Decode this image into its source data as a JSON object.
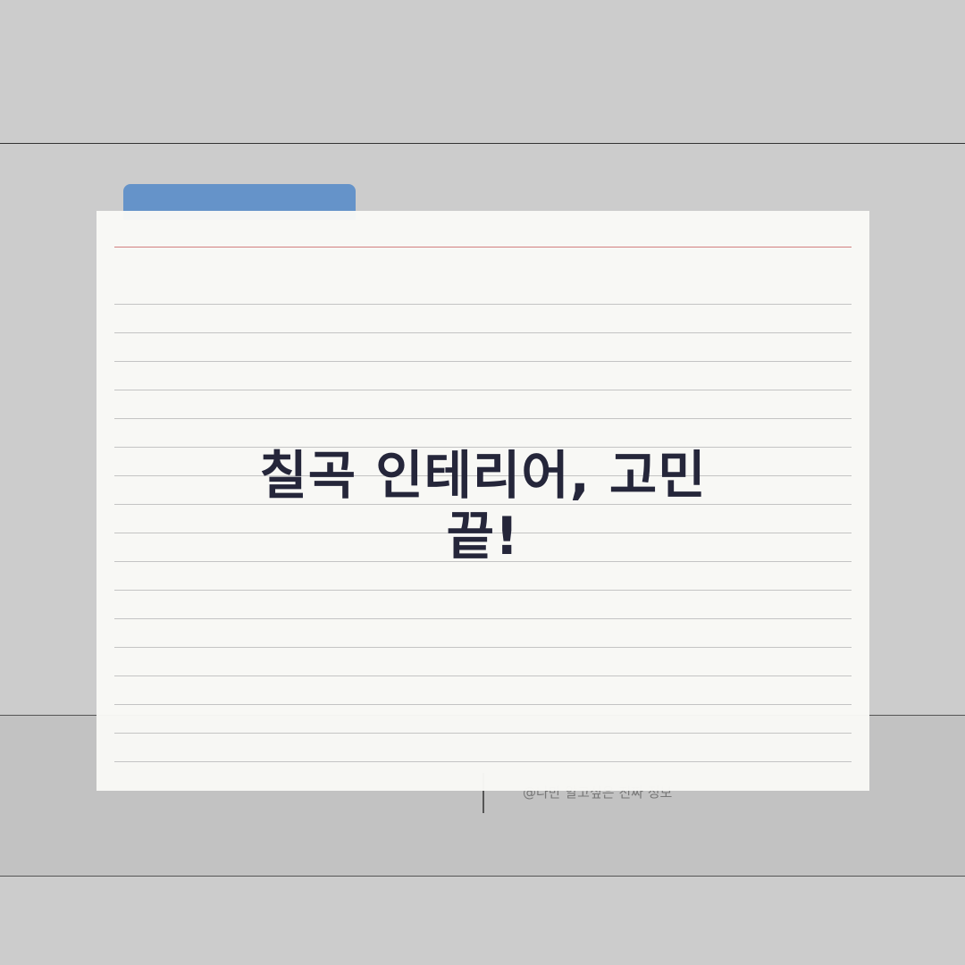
{
  "card": {
    "title_line1": "칠곡 인테리어, 고민",
    "title_line2": "끝!"
  },
  "footer": {
    "credit": "@나만 알고싶은 진짜 정보"
  },
  "colors": {
    "background": "#cccccc",
    "band": "#c2c2c2",
    "tab_accent": "#6593c9",
    "card": "#f9f9f6",
    "margin_line": "#d27f7f",
    "title_text": "#25263a"
  }
}
